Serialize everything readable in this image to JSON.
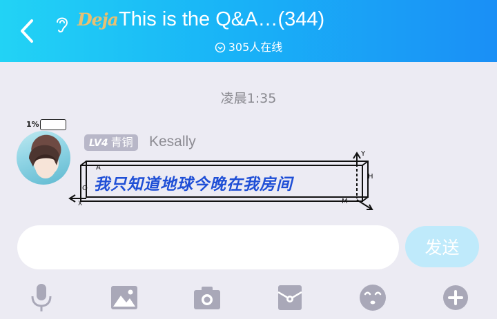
{
  "header": {
    "back_label": "back",
    "logo_text": "Deja",
    "title": "This is the Q&A…(344)",
    "online_count": "305人在线"
  },
  "chat": {
    "timestamp": "凌晨1:35",
    "messages": [
      {
        "battery_text": "1%",
        "level": "LV4",
        "rank": "青铜",
        "username": "Kesally",
        "text": "我只知道地球今晚在我房间"
      }
    ]
  },
  "composer": {
    "input_value": "",
    "input_placeholder": "",
    "send_label": "发送"
  },
  "toolbar": {
    "items": [
      "microphone-icon",
      "image-icon",
      "camera-icon",
      "sticker-pack-icon",
      "emoji-icon",
      "plus-icon"
    ]
  },
  "colors": {
    "header_start": "#22d3f5",
    "header_end": "#1a8ff6",
    "send_button": "#bfeafb",
    "icon_gray": "#a9a8b8",
    "bubble_text": "#1f4fd6"
  }
}
